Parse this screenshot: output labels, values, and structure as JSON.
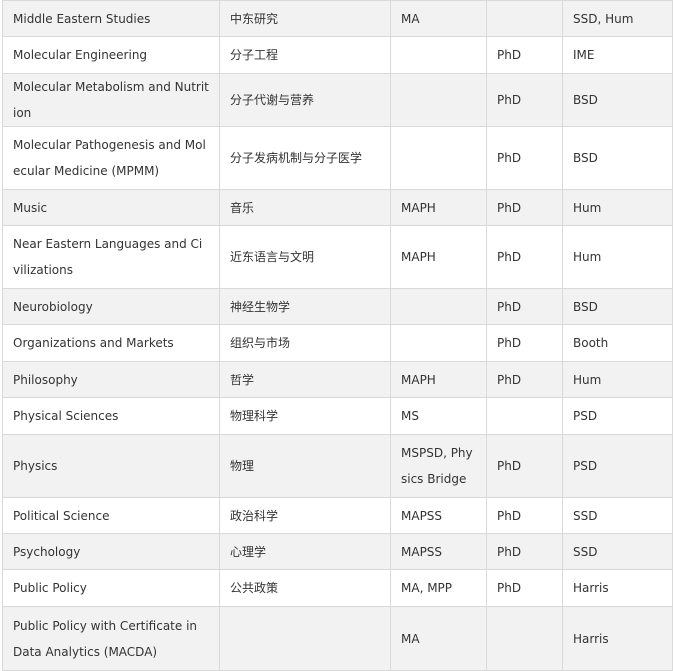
{
  "rows": [
    {
      "program": "Middle  Eastern Studies",
      "chinese": "中东研究",
      "masters": "MA",
      "phd": "",
      "division": "SSD, Hum"
    },
    {
      "program": "Molecular  Engineering",
      "chinese": "分子工程",
      "masters": "",
      "phd": "PhD",
      "division": "IME"
    },
    {
      "program": "Molecular  Metabolism and Nutrition",
      "chinese": "分子代谢与营养",
      "masters": "",
      "phd": "PhD",
      "division": "BSD"
    },
    {
      "program": "Molecular  Pathogenesis and Molecular Medicine (MPMM)",
      "chinese": "分子发病机制与分子医学",
      "masters": "",
      "phd": "PhD",
      "division": "BSD"
    },
    {
      "program": "Music",
      "chinese": "音乐",
      "masters": "MAPH",
      "phd": "PhD",
      "division": "Hum"
    },
    {
      "program": "Near  Eastern Languages and Civilizations",
      "chinese": "近东语言与文明",
      "masters": "MAPH",
      "phd": "PhD",
      "division": "Hum"
    },
    {
      "program": "Neurobiology",
      "chinese": "神经生物学",
      "masters": "",
      "phd": "PhD",
      "division": "BSD"
    },
    {
      "program": "Organizations  and Markets",
      "chinese": "组织与市场",
      "masters": "",
      "phd": "PhD",
      "division": "Booth"
    },
    {
      "program": "Philosophy",
      "chinese": "哲学",
      "masters": "MAPH",
      "phd": "PhD",
      "division": "Hum"
    },
    {
      "program": "Physical  Sciences",
      "chinese": "物理科学",
      "masters": "MS",
      "phd": "",
      "division": "PSD"
    },
    {
      "program": "Physics",
      "chinese": "物理",
      "masters": "MSPSD, Physics Bridge",
      "phd": "PhD",
      "division": "PSD"
    },
    {
      "program": "Political  Science",
      "chinese": "政治科学",
      "masters": "MAPSS",
      "phd": "PhD",
      "division": "SSD"
    },
    {
      "program": "Psychology",
      "chinese": "心理学",
      "masters": "MAPSS",
      "phd": "PhD",
      "division": "SSD"
    },
    {
      "program": "Public  Policy",
      "chinese": "公共政策",
      "masters": "MA, MPP",
      "phd": "PhD",
      "division": "Harris"
    },
    {
      "program": "Public  Policy with Certificate in Data Analytics (MACDA)",
      "chinese": "",
      "masters": "MA",
      "phd": "",
      "division": "Harris"
    }
  ]
}
